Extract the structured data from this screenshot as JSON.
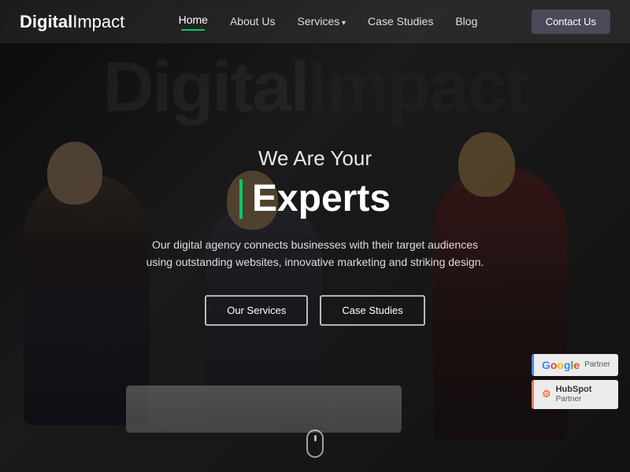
{
  "brand": {
    "name_bold": "Digital",
    "name_light": "Impact"
  },
  "nav": {
    "links": [
      {
        "label": "Home",
        "active": true
      },
      {
        "label": "About Us",
        "active": false
      },
      {
        "label": "Services",
        "active": false,
        "dropdown": true
      },
      {
        "label": "Case Studies",
        "active": false
      },
      {
        "label": "Blog",
        "active": false
      }
    ],
    "cta_label": "Contact Us"
  },
  "hero": {
    "bg_text": "Digital",
    "bg_text2": "Impact",
    "subtitle": "We Are Your",
    "title": "Experts",
    "description": "Our digital agency connects businesses with their target audiences using outstanding websites, innovative marketing and striking design.",
    "btn_services": "Our Services",
    "btn_case_studies": "Case Studies"
  },
  "partners": [
    {
      "name": "Google Partner",
      "type": "google",
      "label_top": "Google",
      "label_bottom": "Partner"
    },
    {
      "name": "HubSpot Partner",
      "type": "hubspot",
      "label_top": "HubSpot",
      "label_bottom": "Partner"
    }
  ],
  "colors": {
    "accent_green": "#00cc66",
    "accent_blue": "#4285f4",
    "accent_orange": "#ff7a59",
    "nav_bg": "rgba(255,255,255,0.07)"
  }
}
